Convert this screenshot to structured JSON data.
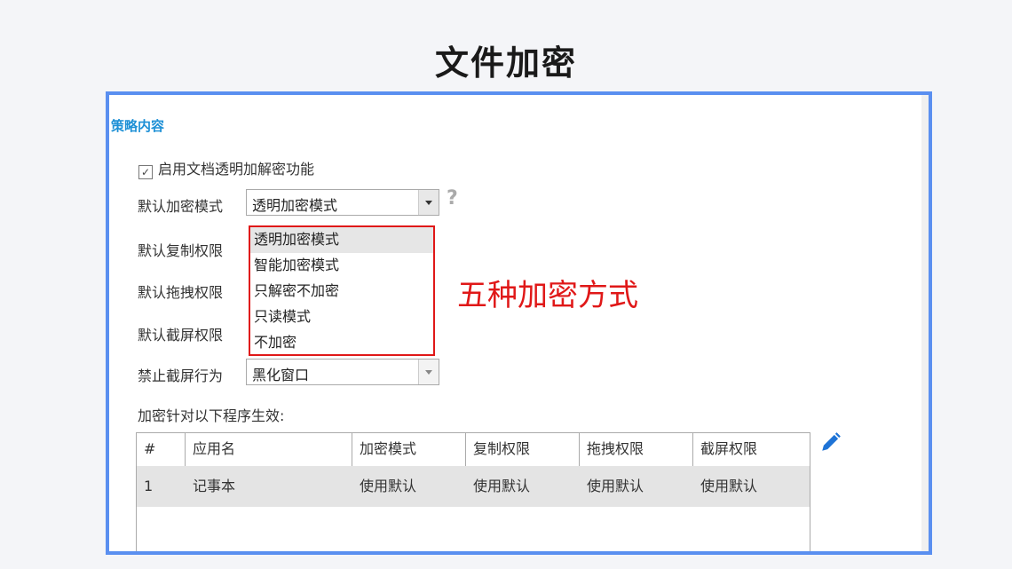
{
  "title": "文件加密",
  "section_title": "策略内容",
  "enable_checkbox": {
    "label": "启用文档透明加解密功能",
    "checked": true
  },
  "fields": {
    "default_encrypt_mode_label": "默认加密模式",
    "default_encrypt_mode_value": "透明加密模式",
    "default_copy_label": "默认复制权限",
    "default_drag_label": "默认拖拽权限",
    "default_screenshot_label": "默认截屏权限",
    "forbid_screenshot_label": "禁止截屏行为",
    "forbid_screenshot_value": "黑化窗口"
  },
  "help_icon": "?",
  "dropdown_options": [
    "透明加密模式",
    "智能加密模式",
    "只解密不加密",
    "只读模式",
    "不加密"
  ],
  "annotation": "五种加密方式",
  "programs_label": "加密针对以下程序生效:",
  "table": {
    "headers": [
      "#",
      "应用名",
      "加密模式",
      "复制权限",
      "拖拽权限",
      "截屏权限"
    ],
    "rows": [
      [
        "1",
        "记事本",
        "使用默认",
        "使用默认",
        "使用默认",
        "使用默认"
      ]
    ]
  },
  "colors": {
    "accent": "#5a8ff0",
    "section": "#1e90d6",
    "annotation": "#e01818",
    "pencil": "#1e73d6"
  },
  "icons": {
    "edit": "pencil-icon",
    "help": "help-icon",
    "dropdown": "chevron-down-icon"
  }
}
